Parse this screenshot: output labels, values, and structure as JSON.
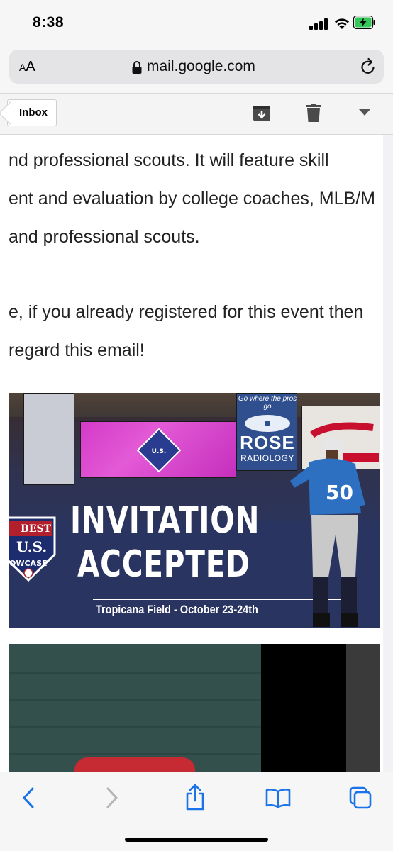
{
  "status": {
    "time": "8:38"
  },
  "browser": {
    "aa_large": "A",
    "aa_small": "A",
    "url": "mail.google.com"
  },
  "toolbar": {
    "back_label": "Inbox"
  },
  "email": {
    "lines": [
      "nd professional scouts. It will feature skill",
      "ent and evaluation by college coaches, MLB/M",
      "and professional scouts.",
      "e, if you already registered for this event then",
      "regard this email!"
    ]
  },
  "banner": {
    "headline_1": "INVITATION",
    "headline_2": "ACCEPTED",
    "subline": "Tropicana Field - October 23-24th",
    "sign_top": "Go where the pros go",
    "sign_word": "ROSE",
    "sign_sub": "RADIOLOGY",
    "jersey_number": "50",
    "logo_line_1": "BEST",
    "logo_line_2": "U.S.",
    "logo_line_3": "OWCASE"
  },
  "colors": {
    "link_blue": "#1a73e8",
    "banner_navy": "#283463",
    "screen_pink": "#d43ac8"
  }
}
